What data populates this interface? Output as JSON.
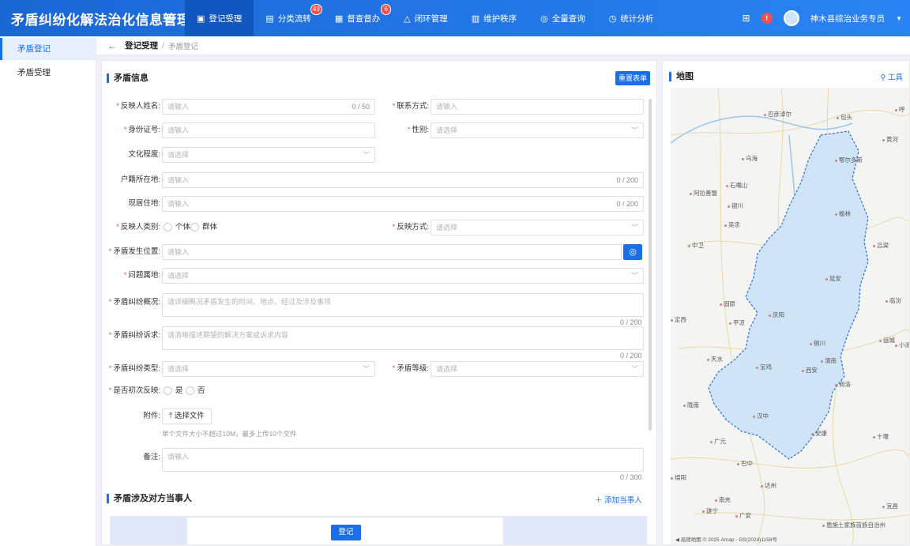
{
  "app": {
    "title": "矛盾纠纷化解法治化信息管理系统",
    "nav": [
      {
        "label": "登记受理",
        "icon": "register-icon",
        "active": true
      },
      {
        "label": "分类流转",
        "icon": "flow-icon",
        "badge": "43"
      },
      {
        "label": "督查督办",
        "icon": "supervise-icon",
        "badge": "6"
      },
      {
        "label": "闭环管理",
        "icon": "loop-icon"
      },
      {
        "label": "维护秩序",
        "icon": "order-icon"
      },
      {
        "label": "全量查询",
        "icon": "query-icon"
      },
      {
        "label": "统计分析",
        "icon": "stats-icon"
      }
    ],
    "user_name": "神木县综治业务专员",
    "alert_icon": "!"
  },
  "sidebar": {
    "items": [
      {
        "label": "矛盾登记",
        "active": true
      },
      {
        "label": "矛盾受理",
        "active": false
      }
    ]
  },
  "breadcrumb": {
    "current": "登记受理",
    "sub": "矛盾登记"
  },
  "form": {
    "section_title": "矛盾信息",
    "reset_label": "重置表单",
    "fields": {
      "name": {
        "label": "反映人姓名:",
        "placeholder": "请输入",
        "count": "0 / 50"
      },
      "contact": {
        "label": "联系方式:",
        "placeholder": "请输入"
      },
      "id_no": {
        "label": "身份证号:",
        "placeholder": "请输入"
      },
      "gender": {
        "label": "性别:",
        "placeholder": "请选择"
      },
      "education": {
        "label": "文化程度:",
        "placeholder": "请选择"
      },
      "hukou": {
        "label": "户籍所在地:",
        "placeholder": "请输入",
        "count": "0 / 200"
      },
      "residence": {
        "label": "现居住地:",
        "placeholder": "请输入",
        "count": "0 / 200"
      },
      "reporter_type": {
        "label": "反映人类别:",
        "options": [
          "个体",
          "群体"
        ]
      },
      "report_method": {
        "label": "反映方式:",
        "placeholder": "请选择"
      },
      "location": {
        "label": "矛盾发生位置:",
        "placeholder": "请输入"
      },
      "territory": {
        "label": "问题属地:",
        "placeholder": "请选择"
      },
      "summary": {
        "label": "矛盾纠纷概况:",
        "placeholder": "请详细概况矛盾发生的时间、地点、经过及涉及事项",
        "count": "0 / 200"
      },
      "demand": {
        "label": "矛盾纠纷诉求:",
        "placeholder": "请清晰描述期望的解决方案或诉求内容",
        "count": "0 / 200"
      },
      "dispute_type": {
        "label": "矛盾纠纷类型:",
        "placeholder": "请选择"
      },
      "level": {
        "label": "矛盾等级:",
        "placeholder": "请选择"
      },
      "first_report": {
        "label": "是否初次反映:",
        "options": [
          "是",
          "否"
        ]
      },
      "attachment": {
        "label": "附件:",
        "button": "选择文件",
        "hint": "单个文件大小不超过10M，最多上传10个文件"
      },
      "remark": {
        "label": "备注:",
        "placeholder": "请输入",
        "count": "0 / 300"
      }
    },
    "parties_title": "矛盾涉及对方当事人",
    "add_party_label": "添加当事人",
    "submit_label": "登记"
  },
  "map": {
    "title": "地图",
    "tool_label": "工具",
    "cities": [
      "巴彦淖尔",
      "包头",
      "呼",
      "鄂尔多斯",
      "乌海",
      "石嘴山",
      "阿拉善盟",
      "银川",
      "吴忠",
      "榆林",
      "中卫",
      "吕梁",
      "延安",
      "临汾",
      "固原",
      "庆阳",
      "定西",
      "平凉",
      "铜川",
      "运城",
      "渭南",
      "天水",
      "宝鸡",
      "西安",
      "商洛",
      "陇南",
      "汉中",
      "安康",
      "十堰",
      "广元",
      "巴中",
      "绵阳",
      "达州",
      "南充",
      "遂宁",
      "广安",
      "宜昌",
      "恩施土家族苗族自治州",
      "小派",
      "黄河"
    ],
    "footer": "◀ 高德地图 © 2025 Amap - GS(2024)1158号",
    "region_color": "#cfe5f7",
    "outline_color": "#2d6fd8"
  },
  "colors": {
    "primary": "#1a6fe8",
    "badge": "#f5504d"
  }
}
